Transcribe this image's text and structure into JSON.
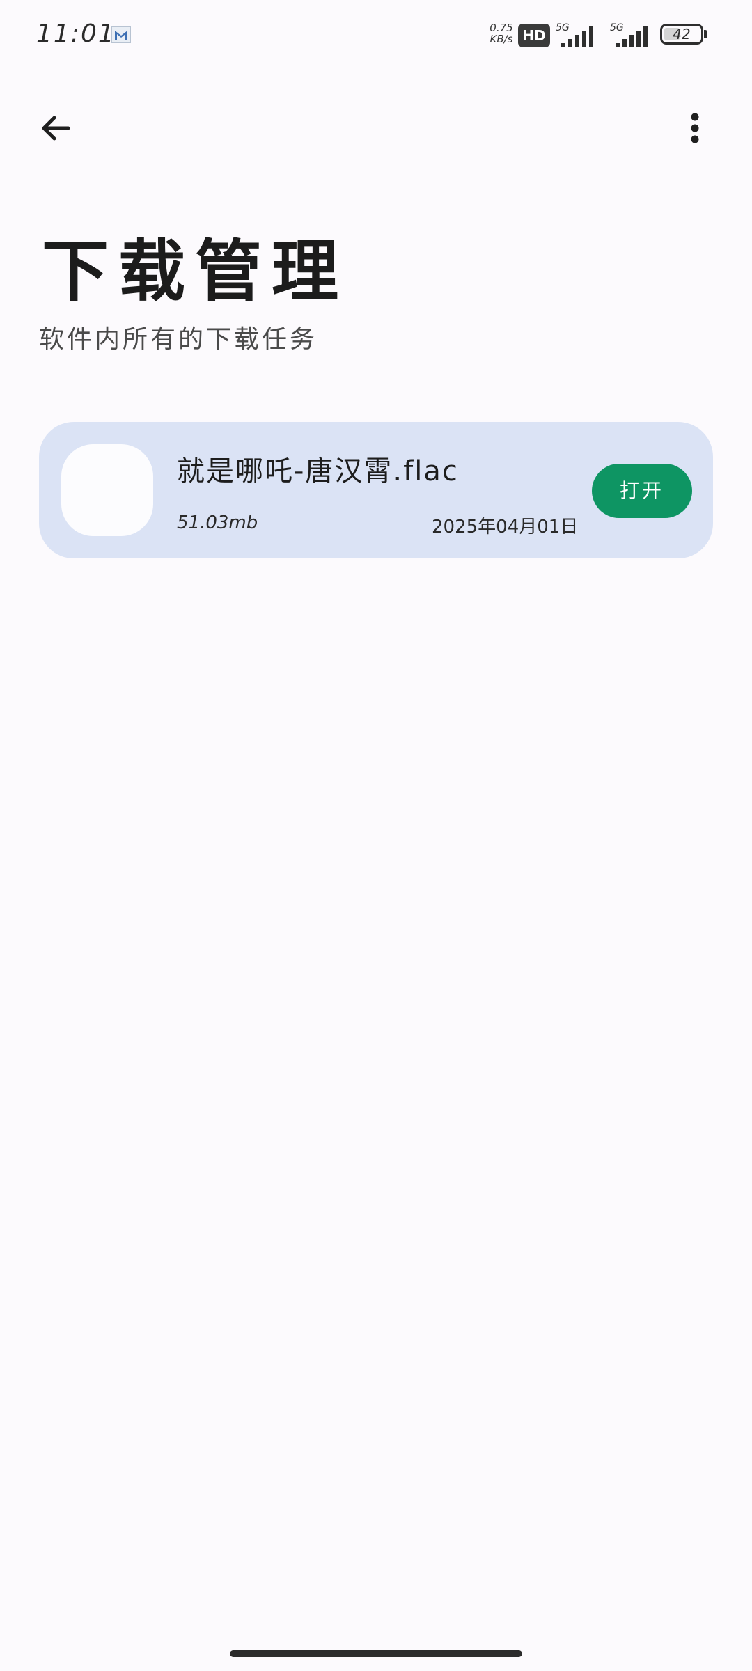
{
  "status_bar": {
    "time": "11:01",
    "net_speed_value": "0.75",
    "net_speed_unit": "KB/s",
    "hd_badge": "HD",
    "sim1_label": "5G",
    "sim2_label": "5G",
    "battery": "42",
    "notification_icon": "gmail-icon"
  },
  "app_bar": {
    "back_icon": "arrow-left-icon",
    "more_icon": "more-vert-icon"
  },
  "page": {
    "title": "下载管理",
    "subtitle": "软件内所有的下载任务"
  },
  "downloads": [
    {
      "file_name": "就是哪吒-唐汉霄.flac",
      "size": "51.03mb",
      "date": "2025年04月01日",
      "action_label": "打开"
    }
  ],
  "colors": {
    "background": "#fcfafd",
    "card": "#dbe3f5",
    "accent": "#0e9563"
  }
}
